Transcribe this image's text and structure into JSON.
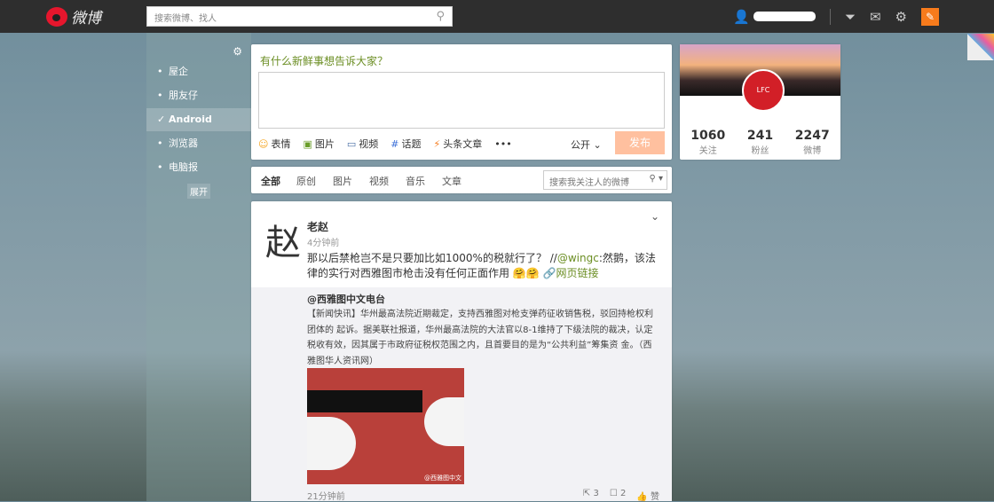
{
  "topbar": {
    "brand": "微博",
    "search_placeholder": "搜索微博、找人"
  },
  "sidebar": {
    "items": [
      {
        "label": "屋企"
      },
      {
        "label": "朋友仔"
      },
      {
        "label": "Android",
        "active": true
      },
      {
        "label": "浏览器"
      },
      {
        "label": "电脑报"
      }
    ],
    "expand": "展开"
  },
  "publisher": {
    "title": "有什么新鲜事想告诉大家？",
    "tools": [
      "表情",
      "图片",
      "视频",
      "话题",
      "头条文章",
      "•••"
    ],
    "visibility": "公开",
    "submit": "发布"
  },
  "feed_tabs": {
    "tabs": [
      "全部",
      "原创",
      "图片",
      "视频",
      "音乐",
      "文章"
    ],
    "search_placeholder": "搜索我关注人的微博"
  },
  "post": {
    "avatar_char": "赵",
    "user": "老赵",
    "time": "4分钟前",
    "text": "那以后禁枪岂不是只要加比如1000%的税就行了？ //",
    "mention": "@wingc",
    "text2": ":然鹅，该法律的实行对西雅图市枪击没有任何正面作用 🤗🤗",
    "link": "网页链接",
    "repost": {
      "user": "@西雅图中文电台",
      "text": "【新闻快讯】华州最高法院近期裁定，支持西雅图对枪支弹药征收销售税，驳回持枪权利团体的 起诉。据美联社报道，华州最高法院的大法官以8-1维持了下级法院的裁决，认定税收有效，因其属于市政府征税权范围之内，且首要目的是为“公共利益”筹集资 金。（西雅图华人资讯网）",
      "watermark": "@西雅图中文",
      "time": "21分钟前",
      "reposts": "3",
      "comments": "2",
      "like": "赞"
    }
  },
  "profile": {
    "stats": [
      {
        "value": "1060",
        "label": "关注"
      },
      {
        "value": "241",
        "label": "粉丝"
      },
      {
        "value": "2247",
        "label": "微博"
      }
    ]
  }
}
